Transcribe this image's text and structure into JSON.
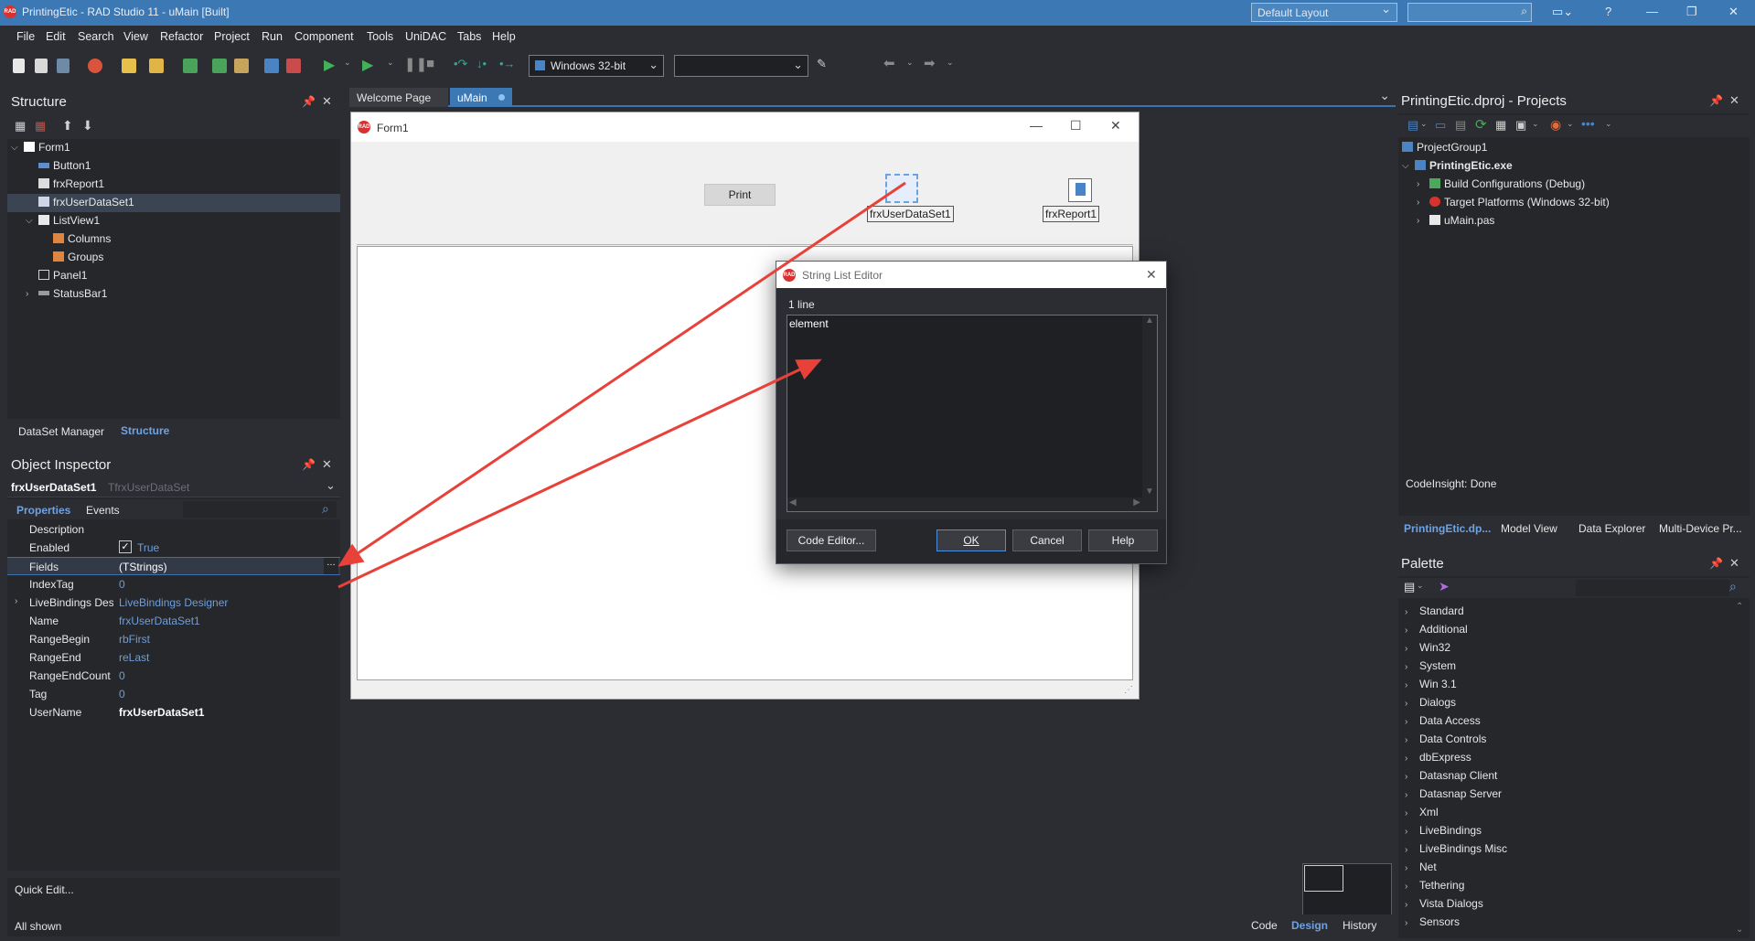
{
  "window": {
    "title": "PrintingEtic - RAD Studio 11 - uMain [Built]",
    "layout_selector": "Default Layout"
  },
  "menu": [
    "File",
    "Edit",
    "Search",
    "View",
    "Refactor",
    "Project",
    "Run",
    "Component",
    "Tools",
    "UniDAC",
    "Tabs",
    "Help"
  ],
  "toolbar": {
    "platform": "Windows 32-bit",
    "config": ""
  },
  "structure": {
    "title": "Structure",
    "items": [
      "Form1",
      "Button1",
      "frxReport1",
      "frxUserDataSet1",
      "ListView1",
      "Columns",
      "Groups",
      "Panel1",
      "StatusBar1"
    ],
    "tabs": [
      "DataSet Manager",
      "Structure"
    ]
  },
  "object_inspector": {
    "title": "Object Inspector",
    "selected_name": "frxUserDataSet1",
    "selected_type": "TfrxUserDataSet",
    "tabs": [
      "Properties",
      "Events"
    ],
    "props": [
      {
        "k": "Description",
        "v": ""
      },
      {
        "k": "Enabled",
        "v": "True"
      },
      {
        "k": "Fields",
        "v": "(TStrings)"
      },
      {
        "k": "IndexTag",
        "v": "0"
      },
      {
        "k": "LiveBindings Designer",
        "v": "LiveBindings Designer"
      },
      {
        "k": "Name",
        "v": "frxUserDataSet1"
      },
      {
        "k": "RangeBegin",
        "v": "rbFirst"
      },
      {
        "k": "RangeEnd",
        "v": "reLast"
      },
      {
        "k": "RangeEndCount",
        "v": "0"
      },
      {
        "k": "Tag",
        "v": "0"
      },
      {
        "k": "UserName",
        "v": "frxUserDataSet1"
      }
    ],
    "quick_edit": "Quick Edit...",
    "all_shown": "All shown"
  },
  "doc_tabs": [
    "Welcome Page",
    "uMain"
  ],
  "form": {
    "caption": "Form1",
    "print_button": "Print",
    "component_dataset": "frxUserDataSet1",
    "component_report": "frxReport1"
  },
  "string_list_editor": {
    "title": "String List Editor",
    "line_count": "1 line",
    "content": "element",
    "buttons": {
      "code_editor": "Code Editor...",
      "ok": "OK",
      "cancel": "Cancel",
      "help": "Help"
    }
  },
  "projects": {
    "title": "PrintingEtic.dproj - Projects",
    "items": [
      "ProjectGroup1",
      "PrintingEtic.exe",
      "Build Configurations (Debug)",
      "Target Platforms (Windows 32-bit)",
      "uMain.pas"
    ],
    "status": "CodeInsight: Done",
    "tabs": [
      "PrintingEtic.dp...",
      "Model View",
      "Data Explorer",
      "Multi-Device Pr..."
    ]
  },
  "palette": {
    "title": "Palette",
    "items": [
      "Standard",
      "Additional",
      "Win32",
      "System",
      "Win 3.1",
      "Dialogs",
      "Data Access",
      "Data Controls",
      "dbExpress",
      "Datasnap Client",
      "Datasnap Server",
      "Xml",
      "LiveBindings",
      "LiveBindings Misc",
      "Net",
      "Tethering",
      "Vista Dialogs",
      "Sensors"
    ]
  },
  "bottom_tabs": [
    "Code",
    "Design",
    "History"
  ],
  "colors": {
    "accent": "#3c78b4",
    "arrow": "#e8413a",
    "link": "#6f9ed8"
  }
}
